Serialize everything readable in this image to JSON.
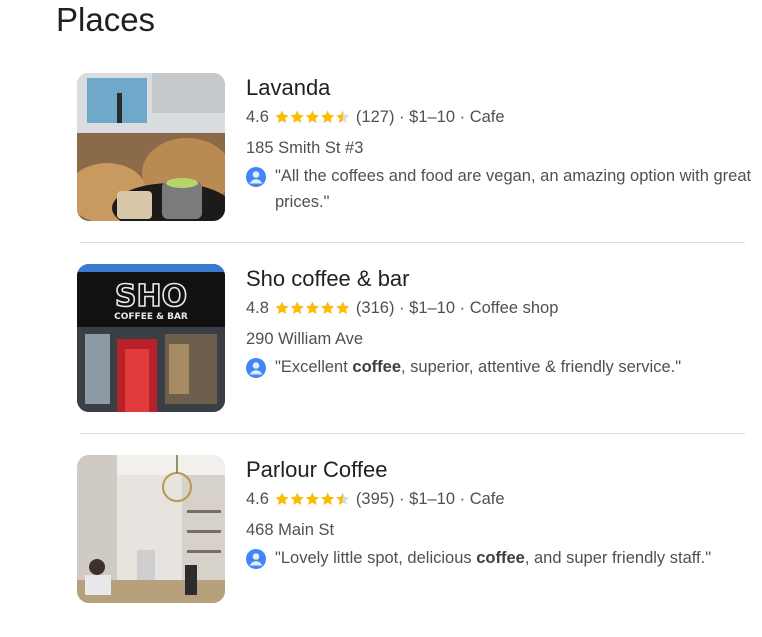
{
  "section": {
    "title": "Places"
  },
  "places": [
    {
      "name": "Lavanda",
      "rating": "4.6",
      "rating_value": 4.6,
      "reviews": "(127)",
      "price": "$1–10",
      "category": "Cafe",
      "address": "185 Smith St #3",
      "review_pre": "\"All the coffees and food are vegan, an amazing option with great prices.\"",
      "review_bold": "",
      "review_post": ""
    },
    {
      "name": "Sho coffee & bar",
      "rating": "4.8",
      "rating_value": 4.8,
      "reviews": "(316)",
      "price": "$1–10",
      "category": "Coffee shop",
      "address": "290 William Ave",
      "review_pre": "\"Excellent ",
      "review_bold": "coffee",
      "review_post": ", superior, attentive & friendly service.\"",
      "sign_text": "SHO",
      "sign_subtext": "COFFEE & BAR"
    },
    {
      "name": "Parlour Coffee",
      "rating": "4.6",
      "rating_value": 4.6,
      "reviews": "(395)",
      "price": "$1–10",
      "category": "Cafe",
      "address": "468 Main St",
      "review_pre": "\"Lovely little spot, delicious ",
      "review_bold": "coffee",
      "review_post": ", and super friendly staff.\""
    }
  ],
  "separator": "·",
  "colors": {
    "star": "#fbbc04",
    "star_empty": "#dadce0",
    "avatar": "#4285f4",
    "text_primary": "#202124",
    "text_secondary": "#4d5156"
  },
  "icons": {
    "star": "star-icon",
    "avatar": "user-avatar-icon"
  }
}
